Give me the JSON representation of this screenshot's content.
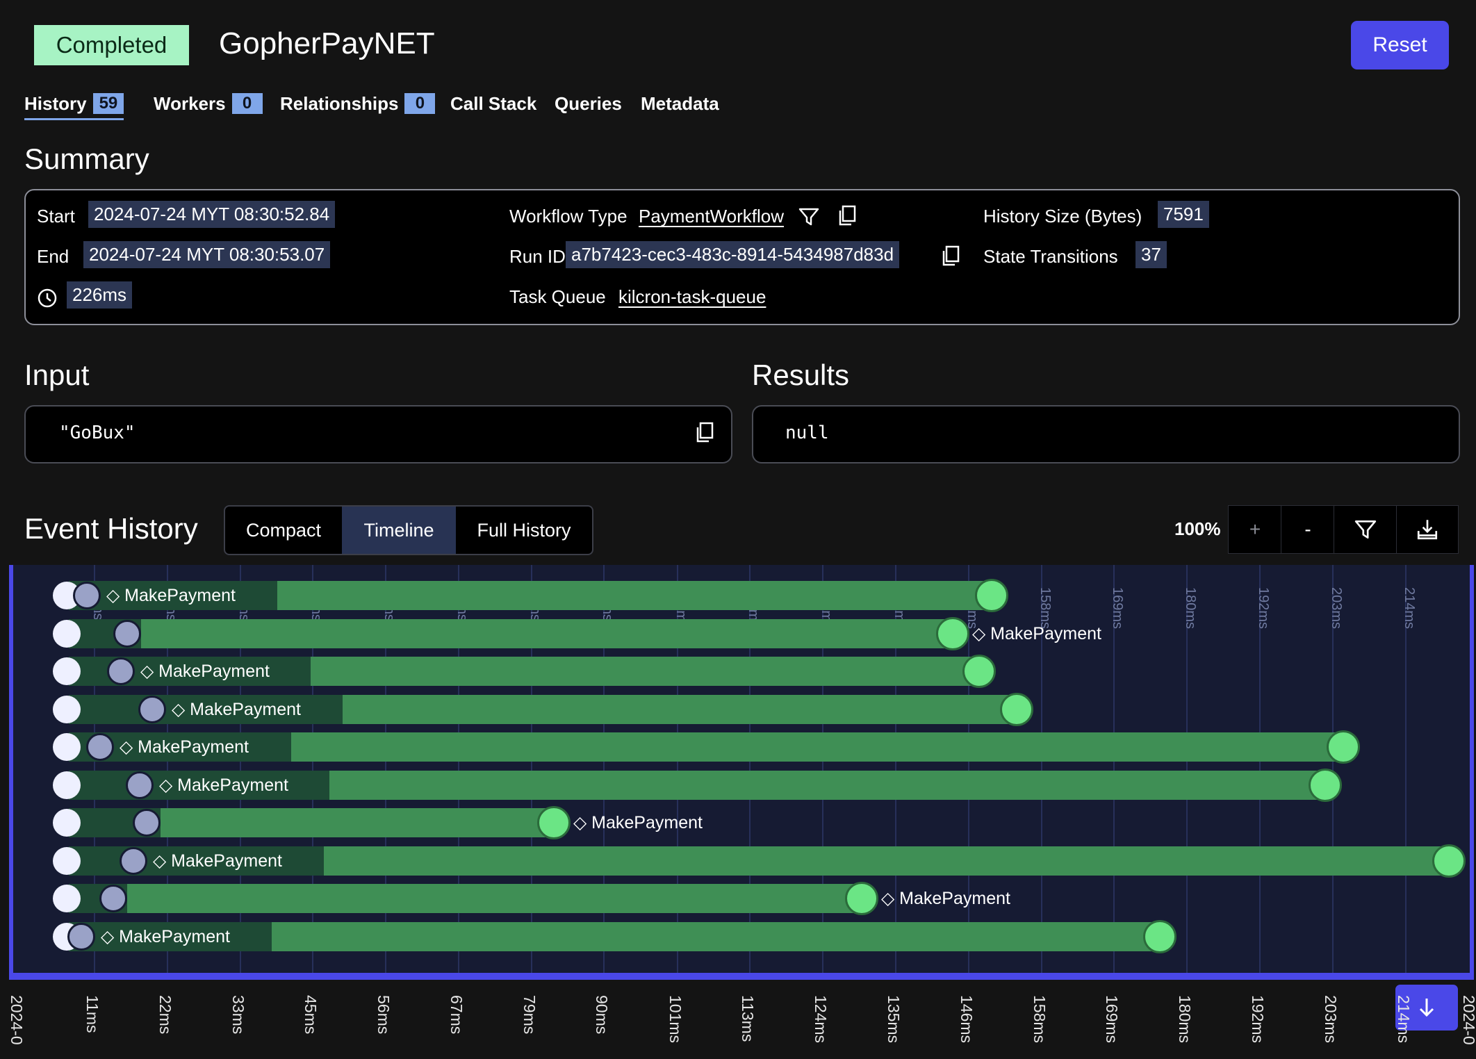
{
  "header": {
    "status": "Completed",
    "title": "GopherPayNET",
    "reset_label": "Reset"
  },
  "tabs": [
    {
      "label": "History",
      "count": "59"
    },
    {
      "label": "Workers",
      "count": "0"
    },
    {
      "label": "Relationships",
      "count": "0"
    },
    {
      "label": "Call Stack"
    },
    {
      "label": "Queries"
    },
    {
      "label": "Metadata"
    }
  ],
  "summary": {
    "title": "Summary",
    "start_label": "Start",
    "start_value": "2024-07-24 MYT 08:30:52.84",
    "end_label": "End",
    "end_value": "2024-07-24 MYT 08:30:53.07",
    "duration_value": "226ms",
    "workflow_type_label": "Workflow Type",
    "workflow_type_value": "PaymentWorkflow",
    "run_id_label": "Run ID",
    "run_id_value": "a7b7423-cec3-483c-8914-5434987d83d",
    "task_queue_label": "Task Queue",
    "task_queue_value": "kilcron-task-queue",
    "history_size_label": "History Size (Bytes)",
    "history_size_value": "7591",
    "state_transitions_label": "State Transitions",
    "state_transitions_value": "37"
  },
  "input": {
    "title": "Input",
    "value": "\"GoBux\""
  },
  "results": {
    "title": "Results",
    "value": "null"
  },
  "event_history": {
    "title": "Event History",
    "views": [
      "Compact",
      "Timeline",
      "Full History"
    ],
    "active_view": "Timeline",
    "zoom_level": "100%",
    "zoom_in_label": "+",
    "zoom_out_label": "-"
  },
  "timeline": {
    "activity_name": "MakePayment",
    "axis_start_label": "2024-0",
    "axis_end_label": "2024-0",
    "axis_ticks": [
      "11ms",
      "22ms",
      "33ms",
      "45ms",
      "56ms",
      "67ms",
      "79ms",
      "90ms",
      "101ms",
      "113ms",
      "124ms",
      "135ms",
      "146ms",
      "158ms",
      "169ms",
      "180ms",
      "192ms",
      "203ms",
      "214ms"
    ],
    "rows": [
      {
        "label": "MakePayment"
      },
      {
        "label": "MakePayment"
      },
      {
        "label": "MakePayment"
      },
      {
        "label": "MakePayment"
      },
      {
        "label": "MakePayment"
      },
      {
        "label": "MakePayment"
      },
      {
        "label": "MakePayment"
      },
      {
        "label": "MakePayment"
      },
      {
        "label": "MakePayment"
      },
      {
        "label": "MakePayment"
      }
    ]
  }
}
